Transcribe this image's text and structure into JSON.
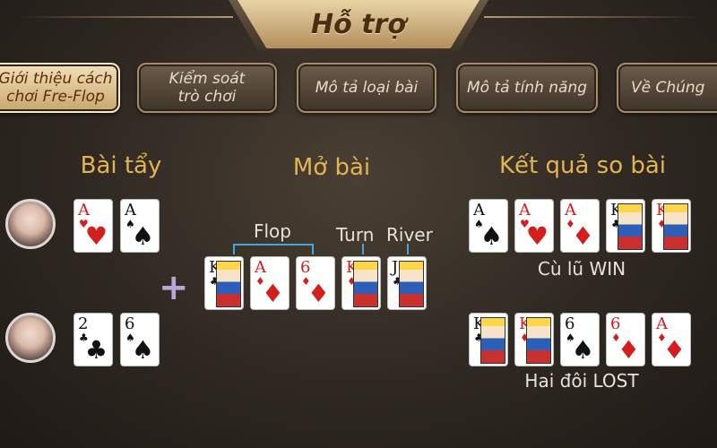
{
  "header": {
    "title": "Hỗ trợ"
  },
  "tabs": [
    {
      "label": "Giới thiệu cách\nchơi Fre-Flop",
      "active": true
    },
    {
      "label": "Kiểm soát\ntrò chơi",
      "active": false
    },
    {
      "label": "Mô tả loại bài",
      "active": false
    },
    {
      "label": "Mô tả tính năng",
      "active": false
    },
    {
      "label": "Về Chúng",
      "active": false
    }
  ],
  "sections": {
    "hole_cards": "Bài tẩy",
    "community": "Mở bài",
    "result": "Kết quả so bài"
  },
  "labels": {
    "flop": "Flop",
    "turn": "Turn",
    "river": "River"
  },
  "players": [
    {
      "avatar": "player-1-avatar",
      "cards": [
        {
          "rank": "A",
          "suit": "♥",
          "color": "red"
        },
        {
          "rank": "A",
          "suit": "♠",
          "color": "black"
        }
      ]
    },
    {
      "avatar": "player-2-avatar",
      "cards": [
        {
          "rank": "2",
          "suit": "♣",
          "color": "black"
        },
        {
          "rank": "6",
          "suit": "♠",
          "color": "black"
        }
      ]
    }
  ],
  "community_cards": [
    {
      "rank": "K",
      "suit": "♣",
      "color": "black",
      "face": true
    },
    {
      "rank": "A",
      "suit": "♦",
      "color": "red"
    },
    {
      "rank": "6",
      "suit": "♦",
      "color": "red"
    },
    {
      "rank": "K",
      "suit": "♦",
      "color": "red",
      "face": true
    },
    {
      "rank": "J",
      "suit": "♣",
      "color": "black",
      "face": true
    }
  ],
  "results": [
    {
      "cards": [
        {
          "rank": "A",
          "suit": "♠",
          "color": "black"
        },
        {
          "rank": "A",
          "suit": "♥",
          "color": "red"
        },
        {
          "rank": "A",
          "suit": "♦",
          "color": "red"
        },
        {
          "rank": "K",
          "suit": "♣",
          "color": "black",
          "face": true
        },
        {
          "rank": "K",
          "suit": "♦",
          "color": "red",
          "face": true
        }
      ],
      "label": "Cù lũ WIN"
    },
    {
      "cards": [
        {
          "rank": "K",
          "suit": "♣",
          "color": "black",
          "face": true
        },
        {
          "rank": "K",
          "suit": "♦",
          "color": "red",
          "face": true
        },
        {
          "rank": "6",
          "suit": "♠",
          "color": "black"
        },
        {
          "rank": "6",
          "suit": "♦",
          "color": "red"
        },
        {
          "rank": "A",
          "suit": "♦",
          "color": "red"
        }
      ],
      "label": "Hai đôi LOST"
    }
  ]
}
